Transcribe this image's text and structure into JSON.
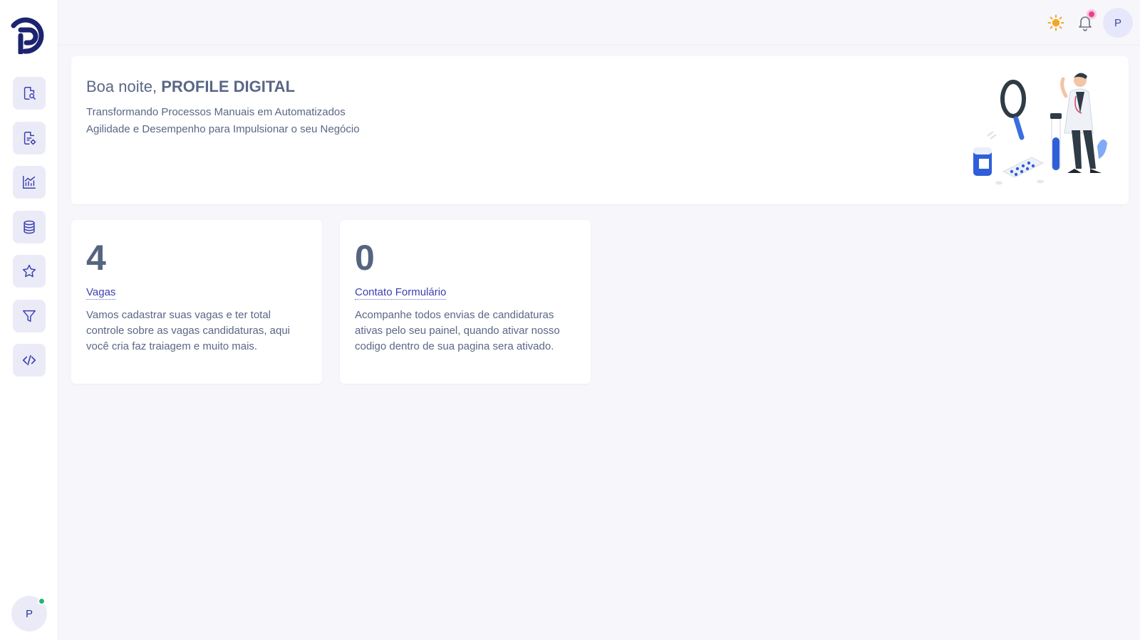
{
  "sidebar": {
    "logo": "pd-logo",
    "items": [
      {
        "icon": "document-search-icon"
      },
      {
        "icon": "document-edit-icon"
      },
      {
        "icon": "chart-icon"
      },
      {
        "icon": "database-icon"
      },
      {
        "icon": "star-icon"
      },
      {
        "icon": "filter-icon"
      },
      {
        "icon": "code-icon"
      }
    ],
    "avatar_initial": "P",
    "status": "online"
  },
  "header": {
    "theme_icon": "sun-icon",
    "notifications_icon": "bell-icon",
    "avatar_initial": "P"
  },
  "welcome": {
    "greeting_prefix": "Boa noite,",
    "name": "PROFILE DIGITAL",
    "line1": "Transformando Processos Manuais em Automatizados",
    "line2": "Agilidade e Desempenho para Impulsionar o seu Negócio"
  },
  "stats": [
    {
      "value": "4",
      "title": "Vagas",
      "description": "Vamos cadastrar suas vagas e ter total controle sobre as vagas candidaturas, aqui você cria faz traiagem e muito mais."
    },
    {
      "value": "0",
      "title": "Contato Formulário",
      "description": "Acompanhe todos envias de candidaturas ativas pelo seu painel, quando ativar nosso codigo dentro de sua pagina sera ativado."
    }
  ],
  "colors": {
    "accent": "#3b3fb0",
    "nav_bg": "#ebebf8",
    "online": "#22b573",
    "notification": "#e83e8c",
    "sun": "#f5a623"
  }
}
